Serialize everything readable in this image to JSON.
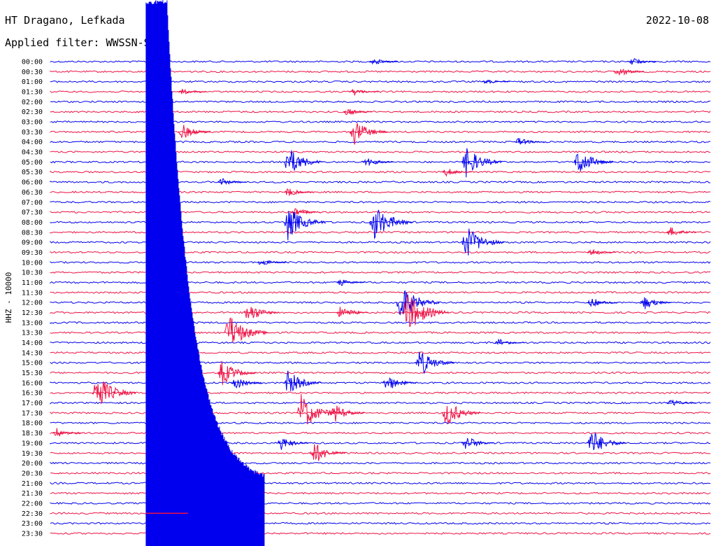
{
  "header": {
    "station": "HT Dragano, Lefkada",
    "date": "2022-10-08",
    "filter": "Applied filter: WWSSN-SP"
  },
  "chart_data": {
    "type": "line",
    "title": "HT Dragano, Lefkada",
    "date": "2022-10-08",
    "filter": "WWSSN-SP",
    "ylabel": "HHZ - 10000",
    "colors": {
      "even": "#0000ee",
      "odd": "#ee1144"
    },
    "rows": [
      "00:00",
      "00:30",
      "01:00",
      "01:30",
      "02:00",
      "02:30",
      "03:00",
      "03:30",
      "04:00",
      "04:30",
      "05:00",
      "05:30",
      "06:00",
      "06:30",
      "07:00",
      "07:30",
      "08:00",
      "08:30",
      "09:00",
      "09:30",
      "10:00",
      "10:30",
      "11:00",
      "11:30",
      "12:00",
      "12:30",
      "13:00",
      "13:30",
      "14:00",
      "14:30",
      "15:00",
      "15:30",
      "16:00",
      "16:30",
      "17:00",
      "17:30",
      "18:00",
      "18:30",
      "19:00",
      "19:30",
      "20:00",
      "20:30",
      "21:00",
      "21:30",
      "22:00",
      "22:30",
      "23:00",
      "23:30"
    ],
    "events": [
      {
        "row": 0,
        "t": 0.49,
        "a": 0.4
      },
      {
        "row": 0,
        "t": 0.88,
        "a": 0.5
      },
      {
        "row": 1,
        "t": 0.86,
        "a": 0.6
      },
      {
        "row": 2,
        "t": 0.66,
        "a": 0.4
      },
      {
        "row": 3,
        "t": 0.2,
        "a": 0.35
      },
      {
        "row": 3,
        "t": 0.46,
        "a": 0.45
      },
      {
        "row": 5,
        "t": 0.45,
        "a": 0.45
      },
      {
        "row": 7,
        "t": 0.2,
        "a": 0.9
      },
      {
        "row": 7,
        "t": 0.46,
        "a": 1.5
      },
      {
        "row": 8,
        "t": 0.71,
        "a": 0.5
      },
      {
        "row": 10,
        "t": 0.36,
        "a": 1.8
      },
      {
        "row": 10,
        "t": 0.48,
        "a": 0.6
      },
      {
        "row": 10,
        "t": 0.63,
        "a": 1.8
      },
      {
        "row": 10,
        "t": 0.8,
        "a": 1.6
      },
      {
        "row": 11,
        "t": 0.6,
        "a": 0.5
      },
      {
        "row": 12,
        "t": 0.26,
        "a": 0.45
      },
      {
        "row": 13,
        "t": 0.36,
        "a": 0.55
      },
      {
        "row": 15,
        "t": 0.37,
        "a": 0.6
      },
      {
        "row": 16,
        "t": 0.36,
        "a": 2.0
      },
      {
        "row": 16,
        "t": 0.49,
        "a": 2.2
      },
      {
        "row": 17,
        "t": 0.94,
        "a": 0.6
      },
      {
        "row": 18,
        "t": 0.63,
        "a": 2.0
      },
      {
        "row": 19,
        "t": 0.82,
        "a": 0.45
      },
      {
        "row": 20,
        "t": 0.32,
        "a": 0.45
      },
      {
        "row": 22,
        "t": 0.44,
        "a": 0.4
      },
      {
        "row": 24,
        "t": 0.53,
        "a": 2.2
      },
      {
        "row": 24,
        "t": 0.82,
        "a": 0.6
      },
      {
        "row": 24,
        "t": 0.9,
        "a": 0.8
      },
      {
        "row": 25,
        "t": 0.3,
        "a": 1.2
      },
      {
        "row": 25,
        "t": 0.44,
        "a": 0.8
      },
      {
        "row": 25,
        "t": 0.54,
        "a": 2.5
      },
      {
        "row": 27,
        "t": 0.27,
        "a": 2.2
      },
      {
        "row": 28,
        "t": 0.68,
        "a": 0.5
      },
      {
        "row": 30,
        "t": 0.56,
        "a": 1.6
      },
      {
        "row": 31,
        "t": 0.26,
        "a": 1.5
      },
      {
        "row": 32,
        "t": 0.36,
        "a": 1.5
      },
      {
        "row": 32,
        "t": 0.28,
        "a": 0.8
      },
      {
        "row": 32,
        "t": 0.51,
        "a": 1.0
      },
      {
        "row": 33,
        "t": 0.07,
        "a": 2.2
      },
      {
        "row": 33,
        "t": 0.18,
        "a": 0.9
      },
      {
        "row": 34,
        "t": 0.94,
        "a": 0.5
      },
      {
        "row": 35,
        "t": 0.38,
        "a": 2.2
      },
      {
        "row": 35,
        "t": 0.43,
        "a": 1.1
      },
      {
        "row": 35,
        "t": 0.6,
        "a": 1.6
      },
      {
        "row": 37,
        "t": 0.01,
        "a": 0.6
      },
      {
        "row": 38,
        "t": 0.35,
        "a": 0.8
      },
      {
        "row": 38,
        "t": 0.63,
        "a": 0.9
      },
      {
        "row": 38,
        "t": 0.82,
        "a": 1.6
      },
      {
        "row": 39,
        "t": 0.4,
        "a": 1.3
      },
      {
        "row": 46,
        "t": 0.26,
        "a": 0.4
      }
    ],
    "mainshock": {
      "row": 0,
      "t": 0.145,
      "note": "large saturated event spanning all rows"
    }
  }
}
